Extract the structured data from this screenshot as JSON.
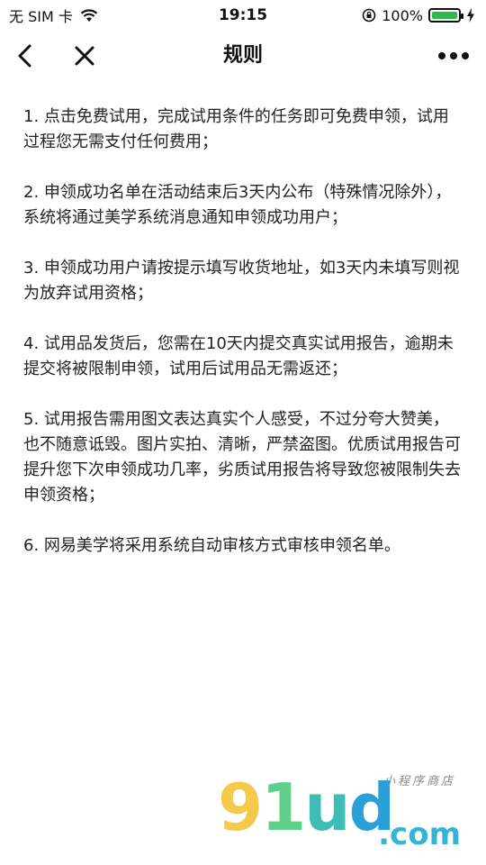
{
  "status_bar": {
    "carrier": "无 SIM 卡",
    "time": "19:15",
    "battery_percent": "100%"
  },
  "nav": {
    "title": "规则"
  },
  "rules": [
    "1. 点击免费试用，完成试用条件的任务即可免费申领，试用过程您无需支付任何费用；",
    "2. 申领成功名单在活动结束后3天内公布（特殊情况除外），系统将通过美学系统消息通知申领成功用户；",
    "3. 申领成功用户请按提示填写收货地址，如3天内未填写则视为放弃试用资格；",
    "4. 试用品发货后，您需在10天内提交真实试用报告，逾期未提交将被限制申领，试用后试用品无需返还；",
    "5. 试用报告需用图文表达真实个人感受，不过分夸大赞美，也不随意诋毁。图片实拍、清晰，严禁盗图。优质试用报告可提升您下次申领成功几率，劣质试用报告将导致您被限制失去申领资格；",
    "6. 网易美学将采用系统自动审核方式审核申领名单。"
  ],
  "watermark": {
    "logo_9": "9",
    "logo_1": "1",
    "logo_u": "u",
    "logo_d": "d",
    "domain": ".com",
    "note": "小程序商店"
  },
  "colors": {
    "battery": "#2db84b"
  }
}
